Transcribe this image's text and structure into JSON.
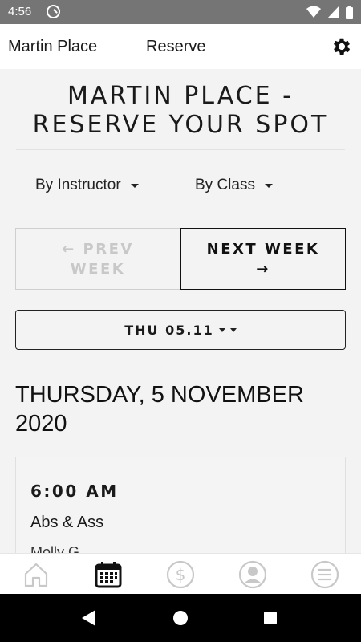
{
  "status_bar": {
    "time": "4:56"
  },
  "app_bar": {
    "location": "Martin Place",
    "section": "Reserve"
  },
  "page_title": "MARTIN PLACE -\nRESERVE YOUR SPOT",
  "filters": {
    "instructor": "By Instructor",
    "class": "By Class"
  },
  "week_nav": {
    "prev": "← PREV WEEK",
    "next": "NEXT WEEK →"
  },
  "date_selector": {
    "value": "THU 05.11"
  },
  "day_heading": "THURSDAY, 5 NOVEMBER 2020",
  "classes": [
    {
      "time": "6:00 AM",
      "name": "Abs & Ass",
      "instructor": "Molly G"
    }
  ],
  "bottom_nav": {
    "items": [
      "home-icon",
      "calendar-icon",
      "dollar-icon",
      "profile-icon",
      "menu-icon"
    ],
    "active": "calendar-icon"
  },
  "colors": {
    "status_bar": "#757575",
    "active_icon": "#111111",
    "inactive_icon": "#c8c8c8"
  }
}
